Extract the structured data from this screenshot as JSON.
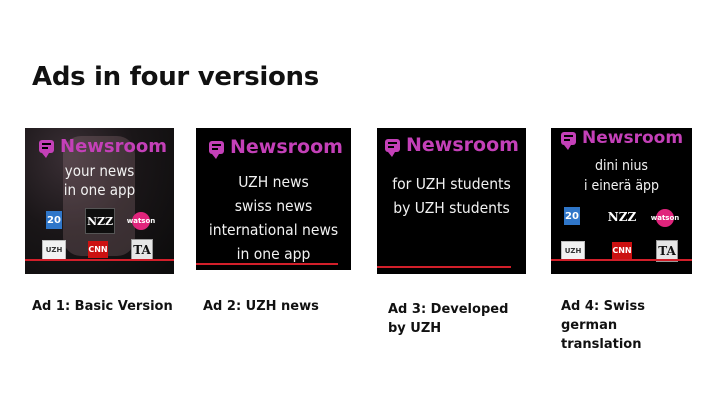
{
  "title": "Ads in four versions",
  "brand_name": "Newsroom",
  "brand_color": "#c440b8",
  "accent_line_color": "#d21f2a",
  "logos": {
    "twenty_min": "20",
    "nzz": "NZZ",
    "watson": "watson",
    "uzh": "UZH",
    "cnn": "CNN",
    "tages_anzeiger": "TA"
  },
  "ads": [
    {
      "lines": [
        "your news",
        "in one app"
      ],
      "caption": "Ad 1: Basic Version"
    },
    {
      "lines": [
        "UZH news",
        "swiss news",
        "international news",
        "in one app"
      ],
      "caption": "Ad 2: UZH news"
    },
    {
      "lines": [
        "for UZH students",
        "by UZH students"
      ],
      "caption_lines": [
        "Ad 3: Developed",
        "by UZH"
      ]
    },
    {
      "lines": [
        "dini nius",
        "i einerä äpp"
      ],
      "caption_lines": [
        "Ad 4: Swiss",
        "german",
        "translation"
      ]
    }
  ]
}
